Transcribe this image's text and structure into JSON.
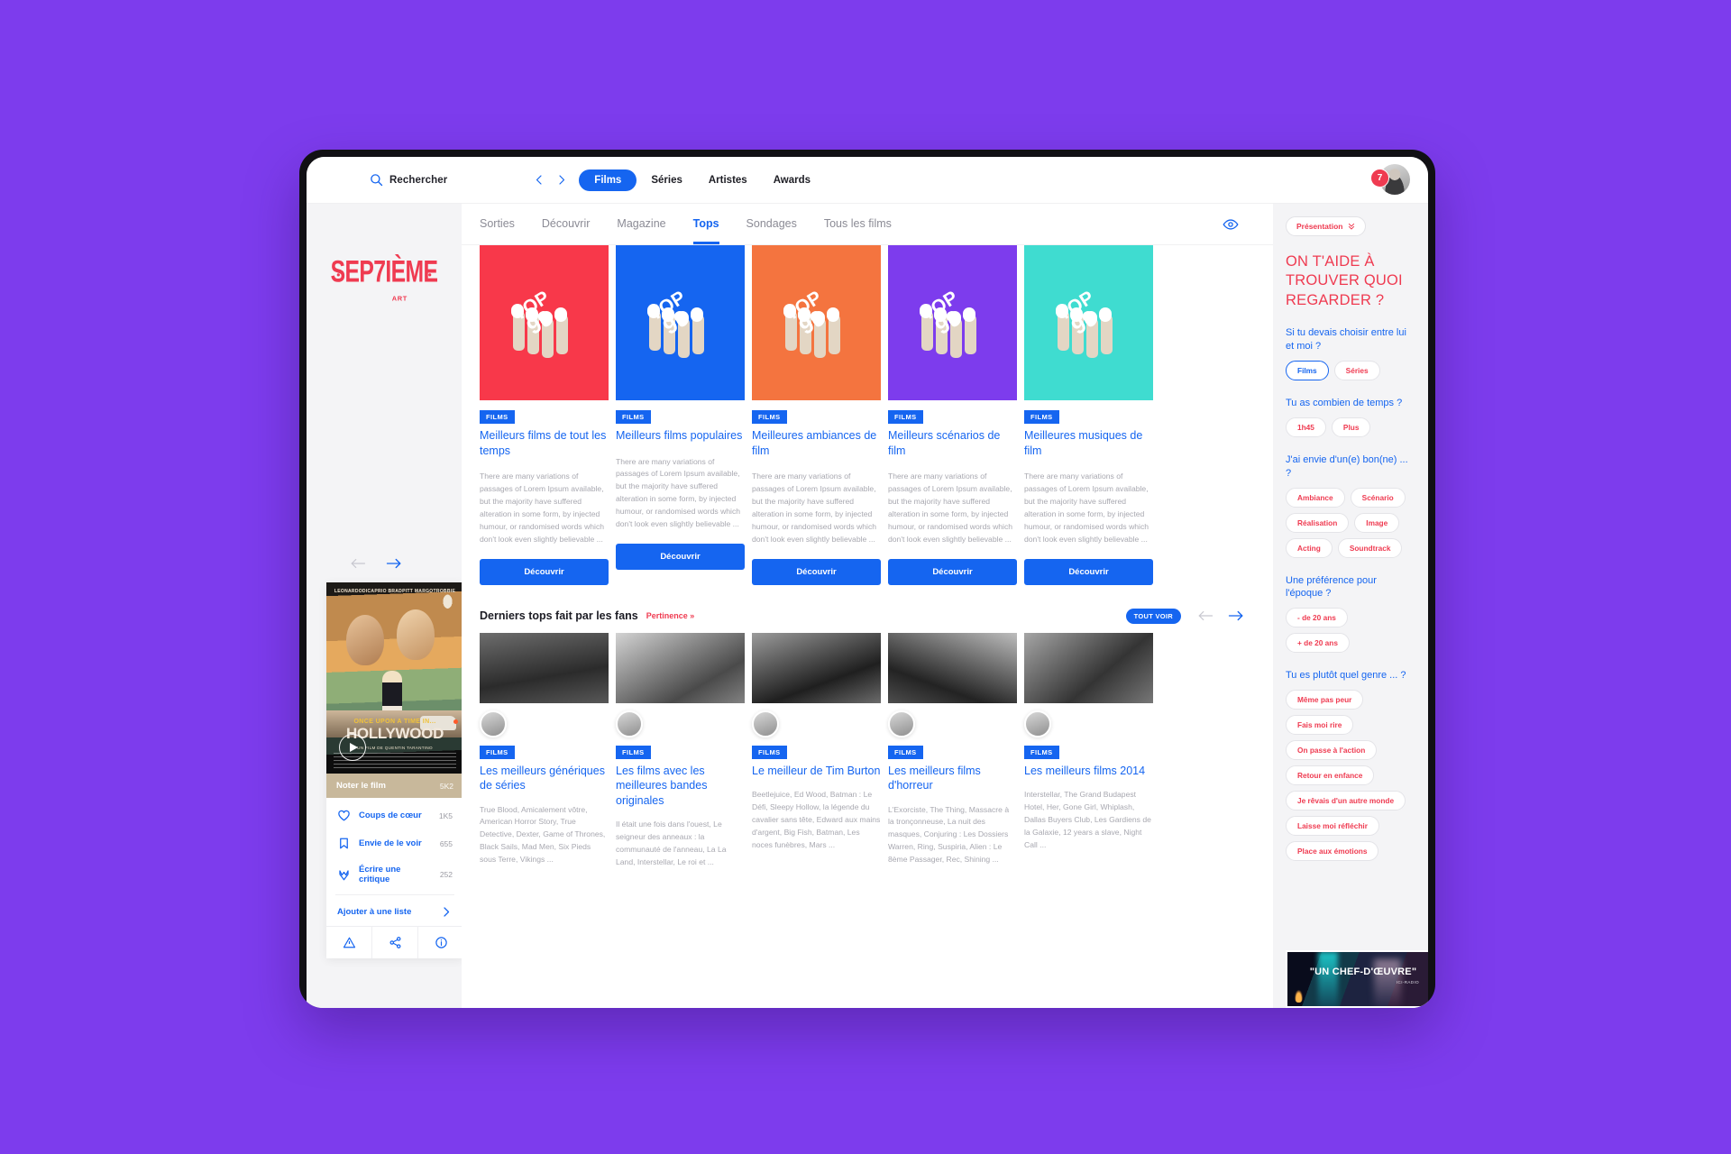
{
  "topbar": {
    "search_placeholder": "Rechercher",
    "nav_prev_icon": "chevron-left-icon",
    "nav_next_icon": "chevron-right-icon",
    "nav_items": [
      {
        "label": "Films",
        "active": true
      },
      {
        "label": "Séries",
        "active": false
      },
      {
        "label": "Artistes",
        "active": false
      },
      {
        "label": "Awards",
        "active": false
      }
    ],
    "notification_count": "7"
  },
  "brand": {
    "logo_text": "SEPTIÈME ART"
  },
  "subnav": {
    "items": [
      {
        "label": "Sorties",
        "active": false
      },
      {
        "label": "Découvrir",
        "active": false
      },
      {
        "label": "Magazine",
        "active": false
      },
      {
        "label": "Tops",
        "active": true
      },
      {
        "label": "Sondages",
        "active": false
      },
      {
        "label": "Tous les films",
        "active": false
      }
    ],
    "eye_icon": "eye-icon"
  },
  "carousel": {
    "prev_icon": "arrow-left-icon",
    "next_icon": "arrow-right-icon"
  },
  "poster": {
    "names": "LEONARDODICAPRIO   BRADPITT   MARGOTROBBIE",
    "title_line1": "ONCE UPON A TIME IN...",
    "title_line2": "HOLLYWOOD",
    "credit": "UN FILM DE QUENTIN TARANTINO",
    "play_icon": "play-icon",
    "rate_label": "Noter le film",
    "rate_count": "5K2",
    "actions": [
      {
        "label": "Coups de cœur",
        "count": "1K5",
        "icon": "heart-icon"
      },
      {
        "label": "Envie de le voir",
        "count": "655",
        "icon": "bookmark-icon"
      },
      {
        "label": "Écrire une critique",
        "count": "252",
        "icon": "pen-icon"
      }
    ],
    "add_to_list": "Ajouter à une liste",
    "footer_icons": [
      "warning-icon",
      "share-icon",
      "info-icon"
    ]
  },
  "top_cards": [
    {
      "tag": "FILMS",
      "title": "Meilleurs films de tout les temps",
      "desc": "There are many variations of passages of Lorem Ipsum available, but the majority have suffered alteration in some form, by injected humour, or randomised words which don't look even slightly believable ...",
      "cta": "Découvrir",
      "bg": "#f8384a",
      "badge": "TOP 99"
    },
    {
      "tag": "FILMS",
      "title": "Meilleurs films populaires",
      "desc": "There are many variations of passages of Lorem Ipsum available, but the majority have suffered alteration in some form, by injected humour, or randomised words which don't look even slightly believable ...",
      "cta": "Découvrir",
      "bg": "#1565f0",
      "badge": "TOP 99"
    },
    {
      "tag": "FILMS",
      "title": "Meilleures ambiances de film",
      "desc": "There are many variations of passages of Lorem Ipsum available, but the majority have suffered alteration in some form, by injected humour, or randomised words which don't look even slightly believable ...",
      "cta": "Découvrir",
      "bg": "#f4743f",
      "badge": "TOP 99"
    },
    {
      "tag": "FILMS",
      "title": "Meilleurs scénarios de film",
      "desc": "There are many variations of passages of Lorem Ipsum available, but the majority have suffered alteration in some form, by injected humour, or randomised words which don't look even slightly believable ...",
      "cta": "Découvrir",
      "bg": "#7d3ced",
      "badge": "TOP 99"
    },
    {
      "tag": "FILMS",
      "title": "Meilleures musiques de film",
      "desc": "There are many variations of passages of Lorem Ipsum available, but the majority have suffered alteration in some form, by injected humour, or randomised words which don't look even slightly believable ...",
      "cta": "Découvrir",
      "bg": "#3fdcd0",
      "badge": "TOP 99"
    }
  ],
  "fans": {
    "title": "Derniers tops fait par les fans",
    "relevance": "Pertinence »",
    "see_all": "TOUT VOIR",
    "prev_icon": "arrow-left-icon",
    "next_icon": "arrow-right-icon",
    "cards": [
      {
        "tag": "FILMS",
        "title": "Les meilleurs génériques de séries",
        "desc": "True Blood, Amicalement vôtre, American Horror Story, True Detective, Dexter, Game of Thrones, Black Sails, Mad Men, Six Pieds sous Terre, Vikings ..."
      },
      {
        "tag": "FILMS",
        "title": "Les films avec les meilleures bandes originales",
        "desc": "Il était une fois dans l'ouest, Le seigneur des anneaux : la communauté de l'anneau, La La Land, Interstellar, Le roi et ..."
      },
      {
        "tag": "FILMS",
        "title": "Le meilleur de Tim Burton",
        "desc": "Beetlejuice, Ed Wood, Batman : Le Défi, Sleepy Hollow, la légende du cavalier sans tête, Edward aux mains d'argent, Big Fish, Batman, Les noces funèbres, Mars  ..."
      },
      {
        "tag": "FILMS",
        "title": "Les meilleurs films d'horreur",
        "desc": "L'Exorciste, The Thing, Massacre à la tronçonneuse, La nuit des masques, Conjuring : Les Dossiers Warren, Ring, Suspiria, Alien : Le 8ème Passager, Rec, Shining ..."
      },
      {
        "tag": "FILMS",
        "title": "Les meilleurs films 2014",
        "desc": "Interstellar, The Grand Budapest Hotel, Her, Gone Girl, Whiplash, Dallas Buyers Club, Les Gardiens de la Galaxie, 12 years a slave, Night Call ..."
      }
    ]
  },
  "right_panel": {
    "presentation_chip": "Présentation",
    "presentation_icon": "chevron-double-down-icon",
    "heading": "ON T'AIDE À TROUVER QUOI REGARDER ?",
    "questions": [
      {
        "label": "Si tu devais choisir entre lui et moi ?",
        "layout": "row",
        "options": [
          {
            "label": "Films",
            "selected": true
          },
          {
            "label": "Séries",
            "selected": false
          }
        ]
      },
      {
        "label": "Tu as combien de temps ?",
        "layout": "row",
        "options": [
          {
            "label": "1h45",
            "selected": false
          },
          {
            "label": "Plus",
            "selected": false
          }
        ]
      },
      {
        "label": "J'ai envie d'un(e) bon(ne) ... ?",
        "layout": "row",
        "options": [
          {
            "label": "Ambiance",
            "selected": false
          },
          {
            "label": "Scénario",
            "selected": false
          },
          {
            "label": "Réalisation",
            "selected": false
          },
          {
            "label": "Image",
            "selected": false
          },
          {
            "label": "Acting",
            "selected": false
          },
          {
            "label": "Soundtrack",
            "selected": false
          }
        ]
      },
      {
        "label": "Une préférence pour l'époque ?",
        "layout": "row",
        "options": [
          {
            "label": "- de 20 ans",
            "selected": false
          },
          {
            "label": "+ de 20 ans",
            "selected": false
          }
        ]
      },
      {
        "label": "Tu es plutôt quel genre ... ?",
        "layout": "col",
        "options": [
          {
            "label": "Même pas peur",
            "selected": false
          },
          {
            "label": "Fais moi rire",
            "selected": false
          },
          {
            "label": "On passe à l'action",
            "selected": false
          },
          {
            "label": "Retour en enfance",
            "selected": false
          },
          {
            "label": "Je rêvais d'un autre monde",
            "selected": false
          },
          {
            "label": "Laisse moi réfléchir",
            "selected": false
          },
          {
            "label": "Place aux émotions",
            "selected": false
          }
        ]
      }
    ],
    "promo": {
      "quote": "\"UN CHEF-D'ŒUVRE\"",
      "source": "ICI-RADIO"
    }
  },
  "colors": {
    "accent_blue": "#1565f0",
    "accent_red": "#ef3b51",
    "background_purple": "#7d3ced",
    "panel_grey": "#f4f4f6"
  }
}
